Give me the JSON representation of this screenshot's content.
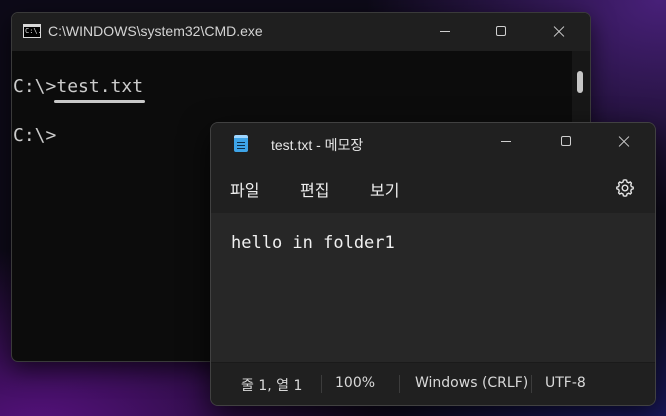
{
  "cmd": {
    "title": "C:\\WINDOWS\\system32\\CMD.exe",
    "icon": "cmd-app-icon",
    "icon_glyph": "C:\\.",
    "lines": [
      {
        "prompt": "C:\\>",
        "command": "test.txt"
      },
      {
        "prompt": "C:\\>",
        "command": ""
      }
    ]
  },
  "notepad": {
    "title": "test.txt - 메모장",
    "icon": "notepad-app-icon",
    "menu": {
      "file": "파일",
      "edit": "편집",
      "view": "보기"
    },
    "content": "hello in folder1",
    "status": {
      "position": "줄 1, 열 1",
      "zoom": "100%",
      "line_ending": "Windows (CRLF)",
      "encoding": "UTF-8"
    }
  },
  "colors": {
    "cmd_background": "#0c0c0c",
    "notepad_background": "#202020",
    "notepad_editor": "#272727",
    "notepad_icon": "#3ea4e8"
  }
}
